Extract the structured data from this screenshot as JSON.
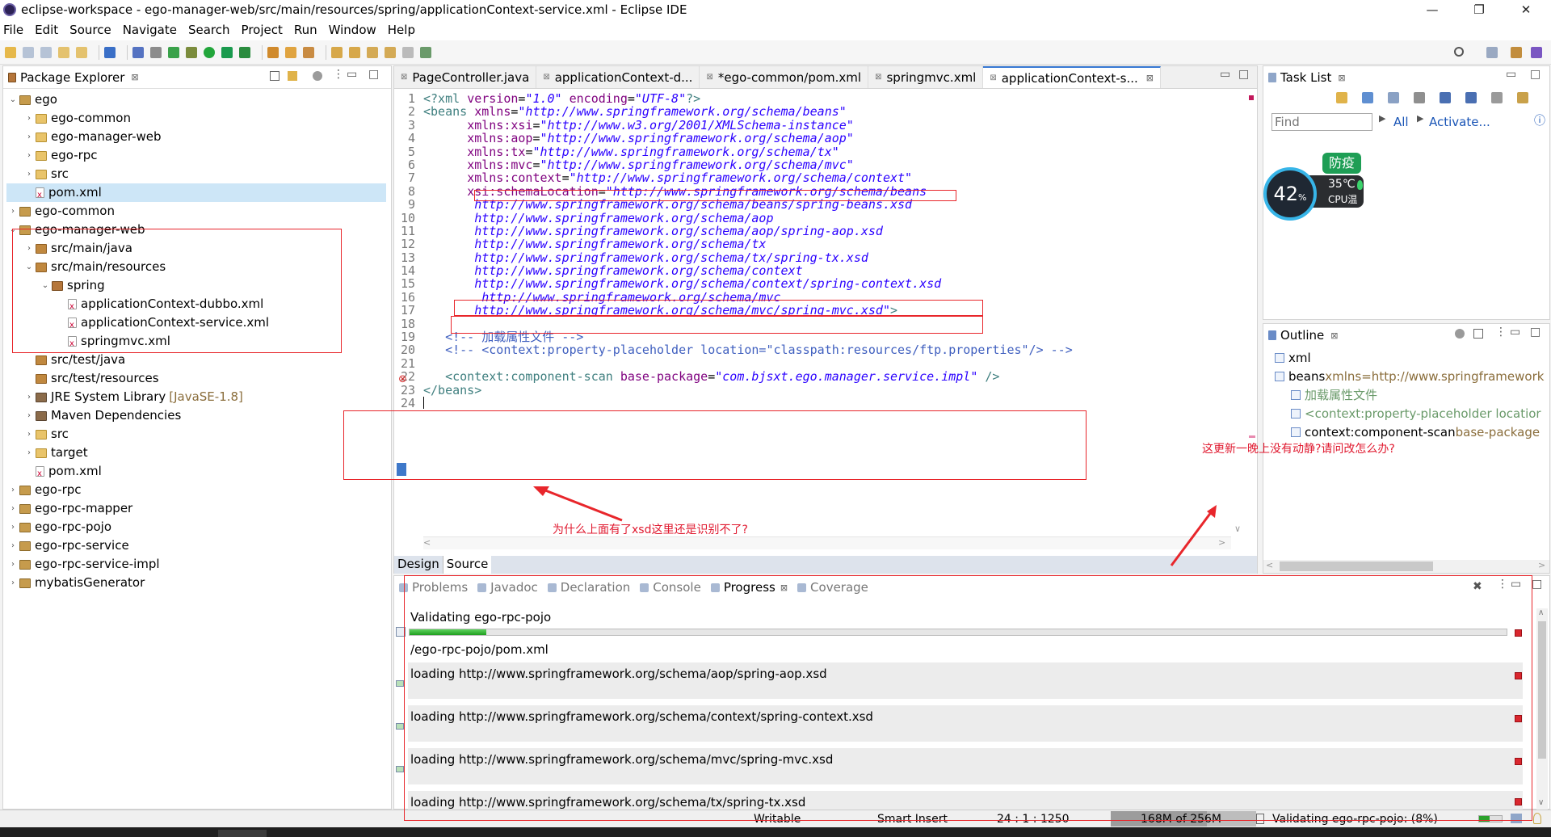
{
  "window": {
    "title": "eclipse-workspace - ego-manager-web/src/main/resources/spring/applicationContext-service.xml - Eclipse IDE",
    "minimize": "—",
    "maximize": "❐",
    "close": "✕"
  },
  "menu": [
    "File",
    "Edit",
    "Source",
    "Navigate",
    "Search",
    "Project",
    "Run",
    "Window",
    "Help"
  ],
  "package_explorer": {
    "title": "Package Explorer",
    "items": [
      {
        "label": "ego",
        "level": 0,
        "arrow": "v",
        "icon": "project-icon"
      },
      {
        "label": "ego-common",
        "level": 1,
        "arrow": ">",
        "icon": "folder-icon"
      },
      {
        "label": "ego-manager-web",
        "level": 1,
        "arrow": ">",
        "icon": "folder-icon"
      },
      {
        "label": "ego-rpc",
        "level": 1,
        "arrow": ">",
        "icon": "folder-icon"
      },
      {
        "label": "src",
        "level": 1,
        "arrow": ">",
        "icon": "folder-icon"
      },
      {
        "label": "pom.xml",
        "level": 1,
        "arrow": "",
        "icon": "pom-icon",
        "selected": true
      },
      {
        "label": "ego-common",
        "level": 0,
        "arrow": ">",
        "icon": "project-icon"
      },
      {
        "label": "ego-manager-web",
        "level": 0,
        "arrow": "v",
        "icon": "project-icon"
      },
      {
        "label": "src/main/java",
        "level": 1,
        "arrow": ">",
        "icon": "source-folder-icon"
      },
      {
        "label": "src/main/resources",
        "level": 1,
        "arrow": "v",
        "icon": "source-folder-icon"
      },
      {
        "label": "spring",
        "level": 2,
        "arrow": "v",
        "icon": "package-icon"
      },
      {
        "label": "applicationContext-dubbo.xml",
        "level": 3,
        "arrow": "",
        "icon": "xml-file-icon"
      },
      {
        "label": "applicationContext-service.xml",
        "level": 3,
        "arrow": "",
        "icon": "xml-file-icon"
      },
      {
        "label": "springmvc.xml",
        "level": 3,
        "arrow": "",
        "icon": "xml-file-icon"
      },
      {
        "label": "src/test/java",
        "level": 1,
        "arrow": "",
        "icon": "source-folder-icon"
      },
      {
        "label": "src/test/resources",
        "level": 1,
        "arrow": "",
        "icon": "source-folder-icon"
      },
      {
        "label": "JRE System Library",
        "suffix": "[JavaSE-1.8]",
        "level": 1,
        "arrow": ">",
        "icon": "library-icon"
      },
      {
        "label": "Maven Dependencies",
        "level": 1,
        "arrow": ">",
        "icon": "library-icon"
      },
      {
        "label": "src",
        "level": 1,
        "arrow": ">",
        "icon": "folder-icon"
      },
      {
        "label": "target",
        "level": 1,
        "arrow": ">",
        "icon": "folder-icon"
      },
      {
        "label": "pom.xml",
        "level": 1,
        "arrow": "",
        "icon": "pom-icon"
      },
      {
        "label": "ego-rpc",
        "level": 0,
        "arrow": ">",
        "icon": "project-icon"
      },
      {
        "label": "ego-rpc-mapper",
        "level": 0,
        "arrow": ">",
        "icon": "project-icon"
      },
      {
        "label": "ego-rpc-pojo",
        "level": 0,
        "arrow": ">",
        "icon": "project-icon"
      },
      {
        "label": "ego-rpc-service",
        "level": 0,
        "arrow": ">",
        "icon": "project-icon"
      },
      {
        "label": "ego-rpc-service-impl",
        "level": 0,
        "arrow": ">",
        "icon": "project-icon"
      },
      {
        "label": "mybatisGenerator",
        "level": 0,
        "arrow": ">",
        "icon": "project-icon"
      }
    ]
  },
  "editor": {
    "tabs": [
      {
        "label": "PageController.java",
        "active": false
      },
      {
        "label": "applicationContext-d...",
        "active": false
      },
      {
        "label": "*ego-common/pom.xml",
        "active": false
      },
      {
        "label": "springmvc.xml",
        "active": false
      },
      {
        "label": "applicationContext-s...",
        "active": true
      }
    ],
    "lines": [
      {
        "n": "1",
        "parts": [
          [
            "pi",
            "<?xml "
          ],
          [
            "att",
            "version"
          ],
          [
            "ct",
            "="
          ],
          [
            "val",
            "\"1.0\""
          ],
          [
            "ct",
            " "
          ],
          [
            "att",
            "encoding"
          ],
          [
            "ct",
            "="
          ],
          [
            "val",
            "\"UTF-8\""
          ],
          [
            "pi",
            "?>"
          ]
        ]
      },
      {
        "n": "2",
        "parts": [
          [
            "tag",
            "<beans "
          ],
          [
            "att",
            "xmlns"
          ],
          [
            "ct",
            "="
          ],
          [
            "val",
            "\"http://www.springframework.org/schema/beans\""
          ]
        ]
      },
      {
        "n": "3",
        "parts": [
          [
            "ct",
            "      "
          ],
          [
            "att",
            "xmlns:xsi"
          ],
          [
            "ct",
            "="
          ],
          [
            "val",
            "\"http://www.w3.org/2001/XMLSchema-instance\""
          ]
        ]
      },
      {
        "n": "4",
        "parts": [
          [
            "ct",
            "      "
          ],
          [
            "att",
            "xmlns:aop"
          ],
          [
            "ct",
            "="
          ],
          [
            "val",
            "\"http://www.springframework.org/schema/aop\""
          ]
        ]
      },
      {
        "n": "5",
        "parts": [
          [
            "ct",
            "      "
          ],
          [
            "att",
            "xmlns:tx"
          ],
          [
            "ct",
            "="
          ],
          [
            "val",
            "\"http://www.springframework.org/schema/tx\""
          ]
        ]
      },
      {
        "n": "6",
        "parts": [
          [
            "ct",
            "      "
          ],
          [
            "att",
            "xmlns:mvc"
          ],
          [
            "ct",
            "="
          ],
          [
            "val",
            "\"http://www.springframework.org/schema/mvc\""
          ]
        ]
      },
      {
        "n": "7",
        "parts": [
          [
            "ct",
            "      "
          ],
          [
            "att",
            "xmlns:context"
          ],
          [
            "ct",
            "="
          ],
          [
            "val",
            "\"http://www.springframework.org/schema/context\""
          ]
        ]
      },
      {
        "n": "8",
        "parts": [
          [
            "ct",
            "      "
          ],
          [
            "att",
            "xsi:schemaLocation"
          ],
          [
            "ct",
            "="
          ],
          [
            "val",
            "\"http://www.springframework.org/schema/beans"
          ]
        ]
      },
      {
        "n": "9",
        "parts": [
          [
            "val",
            "       http://www.springframework.org/schema/beans/spring-beans.xsd"
          ]
        ]
      },
      {
        "n": "10",
        "parts": [
          [
            "val",
            "       http://www.springframework.org/schema/aop"
          ]
        ]
      },
      {
        "n": "11",
        "parts": [
          [
            "val",
            "       http://www.springframework.org/schema/aop/spring-aop.xsd"
          ]
        ]
      },
      {
        "n": "12",
        "parts": [
          [
            "val",
            "       http://www.springframework.org/schema/tx"
          ]
        ]
      },
      {
        "n": "13",
        "parts": [
          [
            "val",
            "       http://www.springframework.org/schema/tx/spring-tx.xsd"
          ]
        ]
      },
      {
        "n": "14",
        "parts": [
          [
            "val",
            "       http://www.springframework.org/schema/context"
          ]
        ]
      },
      {
        "n": "15",
        "parts": [
          [
            "val",
            "       http://www.springframework.org/schema/context/spring-context.xsd"
          ]
        ]
      },
      {
        "n": "16",
        "parts": [
          [
            "val",
            "        http://www.springframework.org/schema/mvc"
          ]
        ]
      },
      {
        "n": "17",
        "parts": [
          [
            "val",
            "       http://www.springframework.org/schema/mvc/spring-mvc.xsd\""
          ],
          [
            "tag",
            ">"
          ]
        ]
      },
      {
        "n": "18",
        "parts": []
      },
      {
        "n": "19",
        "parts": [
          [
            "ct",
            "   "
          ],
          [
            "cmt",
            "<!-- 加载属性文件 -->"
          ]
        ]
      },
      {
        "n": "20",
        "parts": [
          [
            "ct",
            "   "
          ],
          [
            "cmt",
            "<!-- <context:property-placeholder location=\"classpath:resources/ftp.properties\"/> -->"
          ]
        ]
      },
      {
        "n": "21",
        "parts": []
      },
      {
        "n": "22",
        "parts": [
          [
            "ct",
            "   "
          ],
          [
            "tag",
            "<context:component-scan "
          ],
          [
            "att",
            "base-package"
          ],
          [
            "ct",
            "="
          ],
          [
            "val",
            "\"com.bjsxt.ego.manager.service.impl\""
          ],
          [
            "tag",
            " />"
          ]
        ]
      },
      {
        "n": "23",
        "parts": [
          [
            "tag",
            "</beans>"
          ]
        ]
      },
      {
        "n": "24",
        "parts": []
      }
    ],
    "bottom_tabs": [
      "Design",
      "Source"
    ]
  },
  "task_list": {
    "title": "Task List",
    "find_placeholder": "Find",
    "all": "All",
    "activate": "Activate..."
  },
  "widget": {
    "badge": "防疫",
    "percent": "42",
    "pct_sign": "%",
    "temp": "35℃",
    "label": "CPU温度"
  },
  "outline": {
    "title": "Outline",
    "items": [
      {
        "label": "xml",
        "level": 0,
        "prefix": "?-?"
      },
      {
        "label": "beans",
        "extra": " xmlns=http://www.springframework",
        "level": 0
      },
      {
        "label": "加载属性文件",
        "level": 1
      },
      {
        "label": "<context:property-placeholder locatior",
        "level": 1
      },
      {
        "label": "context:component-scan",
        "extra": " base-package",
        "level": 1
      }
    ]
  },
  "bottom_panel": {
    "tabs": [
      "Problems",
      "Javadoc",
      "Declaration",
      "Console",
      "Progress",
      "Coverage"
    ],
    "active_tab": "Progress",
    "job_title": "Validating ego-rpc-pojo",
    "job_progress": 0.07,
    "subtask": "/ego-rpc-pojo/pom.xml",
    "loading": [
      "loading http://www.springframework.org/schema/aop/spring-aop.xsd",
      "loading http://www.springframework.org/schema/context/spring-context.xsd",
      "loading http://www.springframework.org/schema/mvc/spring-mvc.xsd",
      "loading http://www.springframework.org/schema/tx/spring-tx.xsd"
    ]
  },
  "status": {
    "writable": "Writable",
    "insert": "Smart Insert",
    "position": "24 : 1 : 1250",
    "heap": "168M of 256M",
    "job": "Validating ego-rpc-pojo: (8%)"
  },
  "annotations": {
    "question": "为什么上面有了xsd这里还是识别不了?",
    "complaint": "这更新一晚上没有动静?请问改怎么办?"
  },
  "colors": {
    "annotation_red": "#e8262b",
    "progress_green": "#32b432",
    "selected_row": "#cde6f7"
  }
}
